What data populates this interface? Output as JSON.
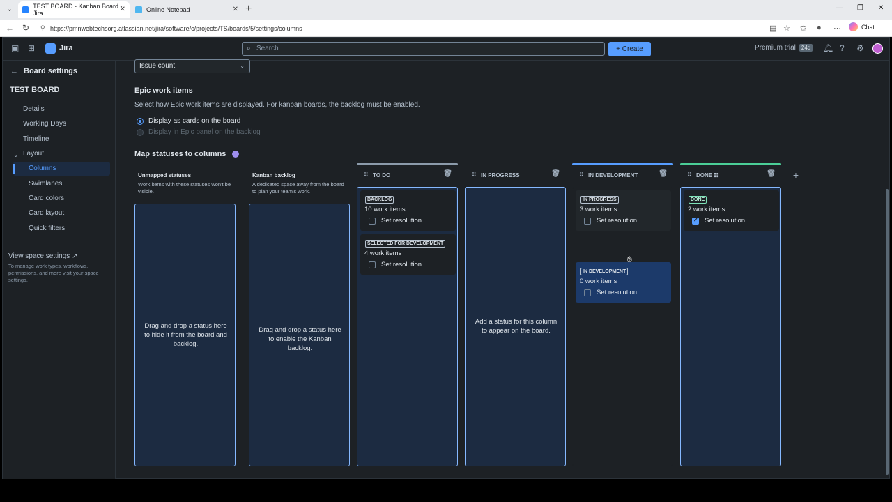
{
  "browser": {
    "tabs": [
      {
        "title": "TEST BOARD - Kanban Board - Jira"
      },
      {
        "title": "Online Notepad"
      }
    ],
    "url": "https://pmnwebtechsorg.atlassian.net/jira/software/c/projects/TS/boards/5/settings/columns",
    "chat_label": "Chat"
  },
  "topnav": {
    "app_name": "Jira",
    "search_placeholder": "Search",
    "create_label": "+ Create",
    "premium_label": "Premium trial",
    "premium_badge": "24d"
  },
  "sidebar": {
    "back_label": "Board settings",
    "board_name": "TEST BOARD",
    "items": [
      "Details",
      "Working Days",
      "Timeline",
      "Layout"
    ],
    "layout_items": [
      "Columns",
      "Swimlanes",
      "Card colors",
      "Card layout",
      "Quick filters"
    ],
    "view_space_label": "View space settings",
    "view_space_desc": "To manage work types, workflows, permissions, and more visit your space settings."
  },
  "main": {
    "select_value": "Issue count",
    "epic_heading": "Epic work items",
    "epic_desc": "Select how Epic work items are displayed. For kanban boards, the backlog must be enabled.",
    "radio_cards": "Display as cards on the board",
    "radio_panel": "Display in Epic panel on the backlog",
    "map_heading": "Map statuses to columns",
    "unmapped": {
      "title": "Unmapped statuses",
      "desc": "Work items with these statuses won't be visible.",
      "drop_text": "Drag and drop a status here to hide it from the board and backlog."
    },
    "kanban": {
      "title": "Kanban backlog",
      "desc": "A dedicated space away from the board to plan your team's work.",
      "drop_text": "Drag and drop a status here to enable the Kanban backlog."
    },
    "columns": {
      "todo": {
        "name": "TO DO",
        "statuses": [
          {
            "label": "BACKLOG",
            "count": "10 work items",
            "res": "Set resolution"
          },
          {
            "label": "SELECTED FOR DEVELOPMENT",
            "count": "4 work items",
            "res": "Set resolution"
          }
        ]
      },
      "inprogress": {
        "name": "IN PROGRESS",
        "drop_text": "Add a status for this column to appear on the board."
      },
      "indev": {
        "name": "IN DEVELOPMENT",
        "statuses": [
          {
            "label": "IN PROGRESS",
            "count": "3 work items",
            "res": "Set resolution"
          },
          {
            "label": "IN DEVELOPMENT",
            "count": "0 work items",
            "res": "Set resolution"
          }
        ]
      },
      "done": {
        "name": "DONE",
        "statuses": [
          {
            "label": "DONE",
            "count": "2 work items",
            "res": "Set resolution",
            "checked": true
          }
        ]
      }
    }
  },
  "colors": {
    "todo_line": "#8c9bab",
    "indev_line": "#579dff",
    "done_line": "#4bce97",
    "accent": "#579dff"
  }
}
